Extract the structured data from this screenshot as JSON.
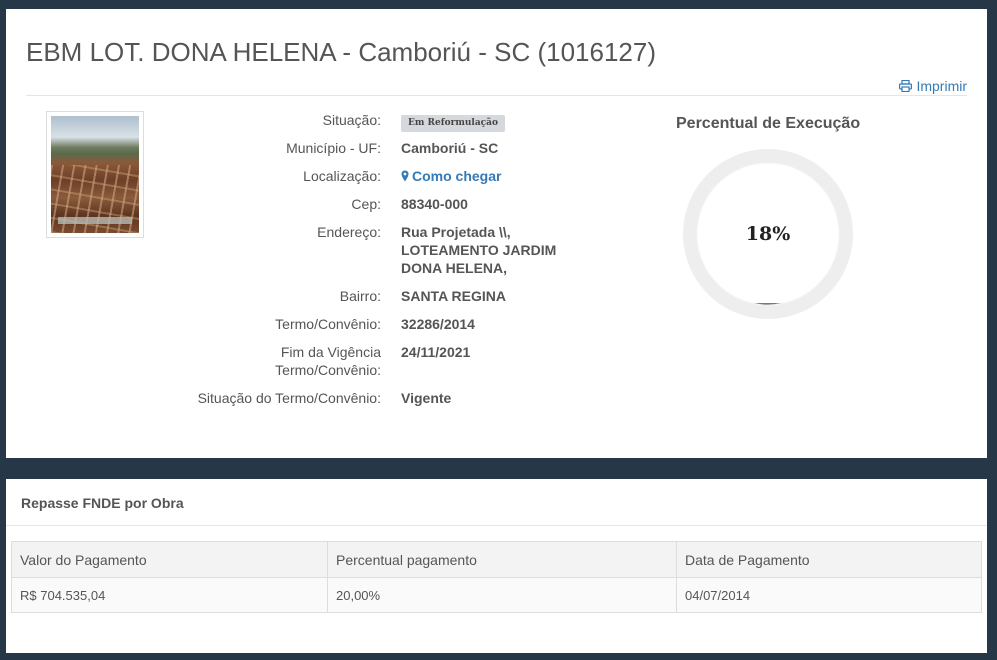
{
  "header": {
    "title": "EBM LOT. DONA HELENA - Camboriú - SC (1016127)",
    "print_label": "Imprimir"
  },
  "details": [
    {
      "label": "Situação:",
      "value": "Em Reformulação",
      "kind": "badge"
    },
    {
      "label": "Município - UF:",
      "value": "Camboriú - SC"
    },
    {
      "label": "Localização:",
      "value": "Como chegar",
      "kind": "link"
    },
    {
      "label": "Cep:",
      "value": "88340-000"
    },
    {
      "label": "Endereço:",
      "value_lines": [
        "Rua Projetada \\\\,",
        "LOTEAMENTO JARDIM",
        "DONA HELENA,"
      ]
    },
    {
      "label": "Bairro:",
      "value": "SANTA REGINA"
    },
    {
      "label": "Termo/Convênio:",
      "value": "32286/2014"
    },
    {
      "label_lines": [
        "Fim da Vigência",
        "Termo/Convênio:"
      ],
      "value": "24/11/2021"
    },
    {
      "label": "Situação do Termo/Convênio:",
      "value": "Vigente"
    }
  ],
  "execution": {
    "title": "Percentual de Execução",
    "percent_label": "18%",
    "percent_value": 18
  },
  "repasse": {
    "title": "Repasse FNDE por Obra",
    "columns": [
      "Valor do Pagamento",
      "Percentual pagamento",
      "Data de Pagamento"
    ],
    "rows": [
      [
        "R$ 704.535,04",
        "20,00%",
        "04/07/2014"
      ]
    ]
  },
  "icons": {
    "print": "printer-icon",
    "location": "map-marker-icon"
  },
  "colors": {
    "background": "#263848",
    "link": "#337ab7",
    "gauge_track": "#eeeeee",
    "gauge_fill": "#555555"
  }
}
